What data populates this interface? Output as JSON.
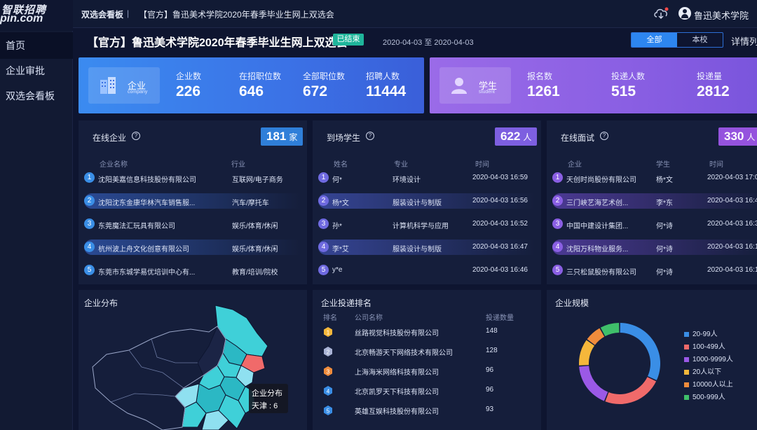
{
  "logo": {
    "cn": "智联招聘",
    "en": "pin.com"
  },
  "nav": [
    {
      "label": "首页",
      "active": true
    },
    {
      "label": "企业审批"
    },
    {
      "label": "双选会看板"
    }
  ],
  "header": {
    "crumb_root": "双选会看板",
    "crumb_sep": "|",
    "crumb_current": "【官方】鲁迅美术学院2020年春季毕业生网上双选会",
    "school": "鲁迅美术学院"
  },
  "title": {
    "text": "【官方】鲁迅美术学院2020年春季毕业生网上双选会",
    "status": "已结束",
    "date_range": "2020-04-03 至 2020-04-03",
    "segment": [
      "全部",
      "本校"
    ],
    "detail_link": "详情列"
  },
  "company_stats": {
    "badge_cn": "企业",
    "badge_en": "company",
    "items": [
      {
        "label": "企业数",
        "value": "226"
      },
      {
        "label": "在招职位数",
        "value": "646"
      },
      {
        "label": "全部职位数",
        "value": "672"
      },
      {
        "label": "招聘人数",
        "value": "11444"
      }
    ]
  },
  "student_stats": {
    "badge_cn": "学生",
    "badge_en": "student",
    "items": [
      {
        "label": "报名数",
        "value": "1261"
      },
      {
        "label": "投递人数",
        "value": "515"
      },
      {
        "label": "投递量",
        "value": "2812"
      }
    ]
  },
  "online_companies": {
    "title": "在线企业",
    "count": "181",
    "unit": "家",
    "headers": [
      "企业名称",
      "行业"
    ],
    "rows": [
      {
        "no": "1",
        "name": "沈阳美嘉信息科技股份有限公司",
        "industry": "互联网/电子商务"
      },
      {
        "no": "2",
        "name": "沈阳沈东金康华林汽车销售服...",
        "industry": "汽车/摩托车"
      },
      {
        "no": "3",
        "name": "东莞魔法汇玩具有限公司",
        "industry": "娱乐/体育/休闲"
      },
      {
        "no": "4",
        "name": "杭州波上舟文化创意有限公司",
        "industry": "娱乐/体育/休闲"
      },
      {
        "no": "5",
        "name": "东莞市东城学易优培训中心有...",
        "industry": "教育/培训/院校"
      }
    ]
  },
  "students": {
    "title": "到场学生",
    "count": "622",
    "unit": "人",
    "headers": [
      "姓名",
      "专业",
      "时间"
    ],
    "rows": [
      {
        "no": "1",
        "name": "何*",
        "major": "环境设计",
        "time": "2020-04-03 16:59"
      },
      {
        "no": "2",
        "name": "杨*文",
        "major": "服装设计与制版",
        "time": "2020-04-03 16:56"
      },
      {
        "no": "3",
        "name": "孙*",
        "major": "计算机科学与应用",
        "time": "2020-04-03 16:52"
      },
      {
        "no": "4",
        "name": "李*艾",
        "major": "服装设计与制版",
        "time": "2020-04-03 16:47"
      },
      {
        "no": "5",
        "name": "y*e",
        "major": "",
        "time": "2020-04-03 16:46"
      }
    ]
  },
  "interviews": {
    "title": "在线面试",
    "count": "330",
    "unit": "人",
    "headers": [
      "企业",
      "学生",
      "时间"
    ],
    "rows": [
      {
        "no": "1",
        "company": "天创时尚股份有限公司",
        "student": "杨*文",
        "time": "2020-04-03 17:0"
      },
      {
        "no": "2",
        "company": "三门峡艺海艺术创...",
        "student": "李*东",
        "time": "2020-04-03 16:4"
      },
      {
        "no": "3",
        "company": "中国中建设计集团...",
        "student": "何*诗",
        "time": "2020-04-03 16:3"
      },
      {
        "no": "4",
        "company": "沈阳万科物业服务...",
        "student": "何*诗",
        "time": "2020-04-03 16:1"
      },
      {
        "no": "5",
        "company": "三只松鼠股份有限公司",
        "student": "何*诗",
        "time": "2020-04-03 16:1"
      }
    ]
  },
  "map": {
    "title": "企业分布",
    "tooltip_title": "企业分布",
    "tooltip_value": "天津 : 6"
  },
  "ranking": {
    "title": "企业投递排名",
    "headers": [
      "排名",
      "公司名称",
      "投递数量"
    ],
    "rows": [
      {
        "rank": "1",
        "company": "丝路视觉科技股份有限公司",
        "count": "148"
      },
      {
        "rank": "2",
        "company": "北京畅游天下网络技术有限公司",
        "count": "128"
      },
      {
        "rank": "3",
        "company": "上海海米网络科技有限公司",
        "count": "96"
      },
      {
        "rank": "4",
        "company": "北京凯罗天下科技有限公司",
        "count": "96"
      },
      {
        "rank": "5",
        "company": "英雄互娱科技股份有限公司",
        "count": "93"
      }
    ]
  },
  "scale": {
    "title": "企业规模",
    "chart_data": {
      "type": "pie",
      "categories": [
        "20-99人",
        "100-499人",
        "1000-9999人",
        "20人以下",
        "10000人以上",
        "500-999人"
      ],
      "values": [
        32,
        24,
        18,
        11,
        7,
        8
      ],
      "colors": [
        "#3a8ee6",
        "#f06a6a",
        "#9b59e6",
        "#f5b73b",
        "#f08c3c",
        "#3fbf6a"
      ]
    }
  }
}
